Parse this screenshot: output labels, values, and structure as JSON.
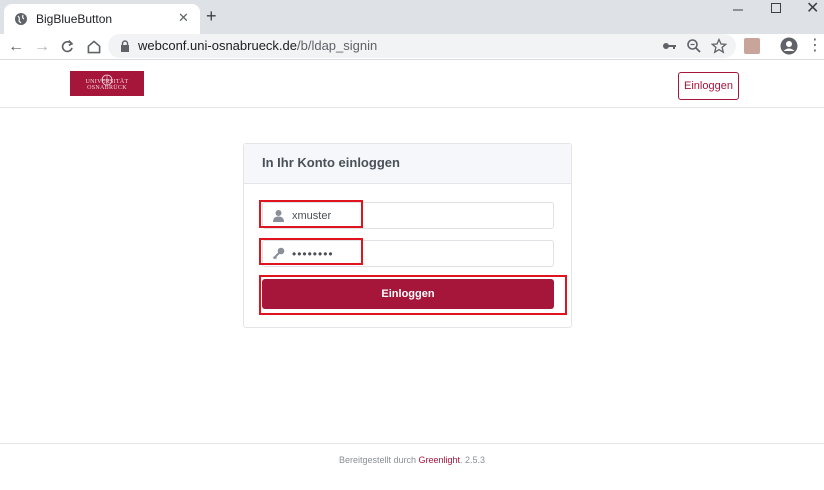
{
  "browser": {
    "tab_title": "BigBlueButton",
    "url_domain": "webconf.uni-osnabrueck.de",
    "url_path": "/b/ldap_signin"
  },
  "header": {
    "logo_text": "UNIVERSITÄT OSNABRÜCK",
    "login_label": "Einloggen"
  },
  "login_card": {
    "title": "In Ihr Konto einloggen",
    "username_value": "xmuster",
    "password_value": "••••••••",
    "submit_label": "Einloggen"
  },
  "footer": {
    "prefix": "Bereitgestellt durch ",
    "link": "Greenlight",
    "version": ". 2.5.3"
  },
  "colors": {
    "brand": "#a6163b",
    "highlight": "#e0141e"
  }
}
